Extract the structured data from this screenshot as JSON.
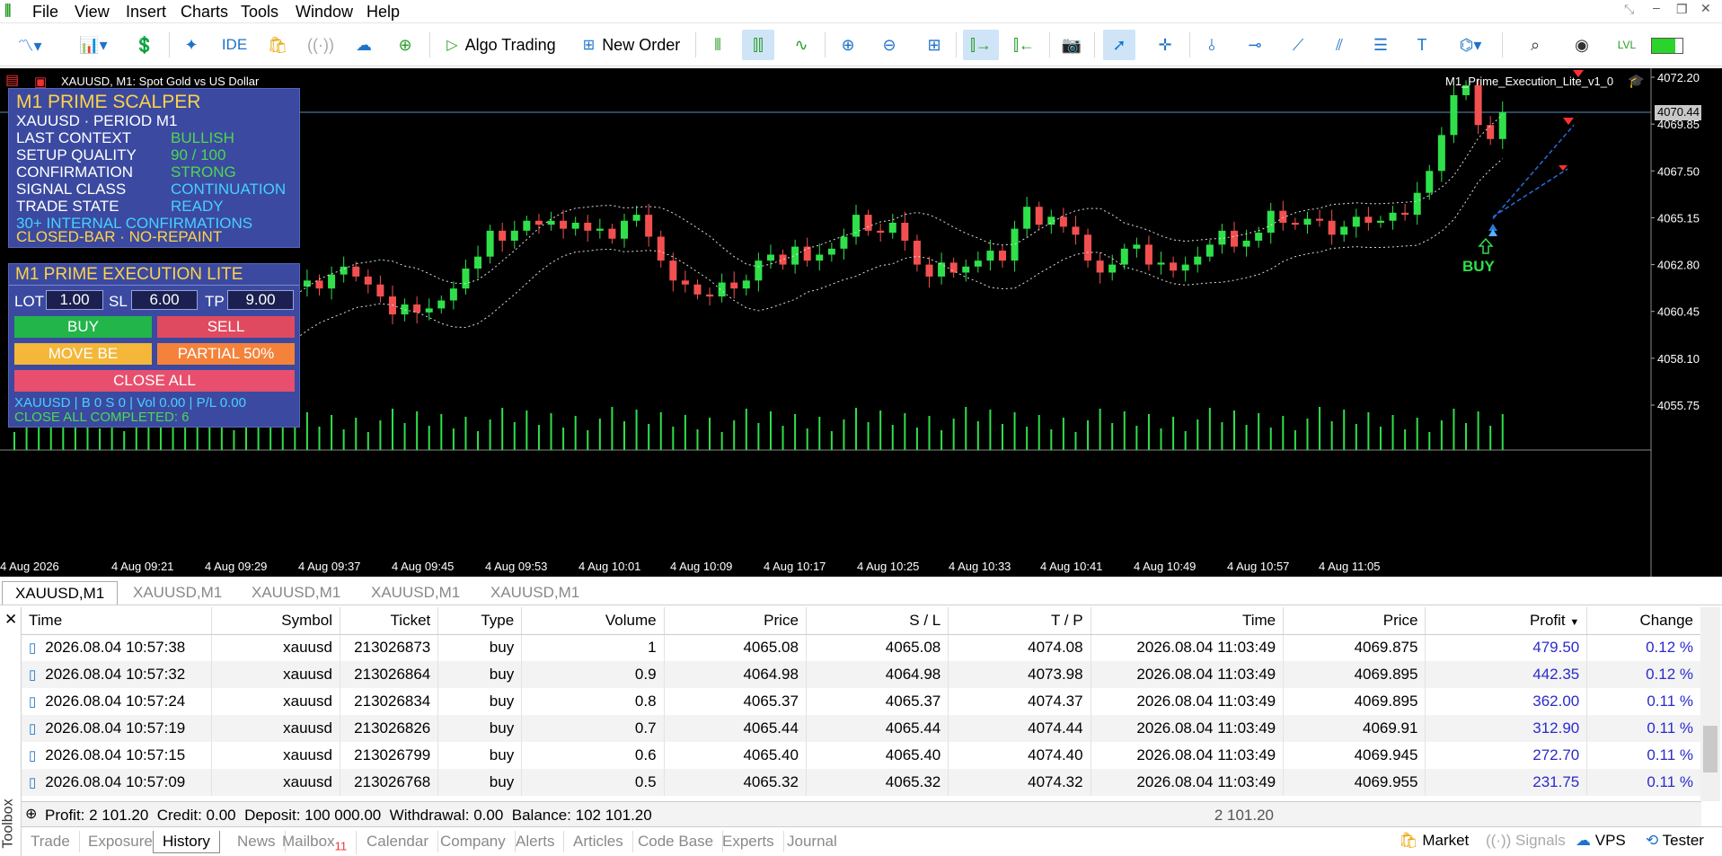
{
  "menu": [
    "File",
    "View",
    "Insert",
    "Charts",
    "Tools",
    "Window",
    "Help"
  ],
  "toolbar": {
    "ide": "IDE",
    "algo_trading": "Algo Trading",
    "new_order": "New Order"
  },
  "chart": {
    "title": "XAUUSD, M1:  Spot Gold vs US Dollar",
    "ea_label": "M1_Prime_Execution_Lite_v1_0",
    "price_labels": [
      "4072.20",
      "4069.85",
      "4067.50",
      "4065.15",
      "4062.80",
      "4060.45",
      "4058.10",
      "4055.75"
    ],
    "current_price": "4070.44",
    "time_labels": [
      "4 Aug 2026",
      "4 Aug 09:21",
      "4 Aug 09:29",
      "4 Aug 09:37",
      "4 Aug 09:45",
      "4 Aug 09:53",
      "4 Aug 10:01",
      "4 Aug 10:09",
      "4 Aug 10:17",
      "4 Aug 10:25",
      "4 Aug 10:33",
      "4 Aug 10:41",
      "4 Aug 10:49",
      "4 Aug 10:57",
      "4 Aug 11:05"
    ],
    "buy_signal": "BUY",
    "up_color": "#2fe04a",
    "down_color": "#f25050"
  },
  "scalper": {
    "title": "M1 PRIME SCALPER",
    "subtitle": "XAUUSD · PERIOD M1",
    "rows": [
      {
        "label": "LAST CONTEXT",
        "value": "BULLISH"
      },
      {
        "label": "SETUP QUALITY",
        "value": "90 / 100"
      },
      {
        "label": "CONFIRMATION",
        "value": "STRONG"
      },
      {
        "label": "SIGNAL CLASS",
        "value": "CONTINUATION"
      },
      {
        "label": "TRADE STATE",
        "value": "READY"
      }
    ],
    "line1": "30+ INTERNAL CONFIRMATIONS",
    "line2": "CLOSED-BAR · NO-REPAINT"
  },
  "execution": {
    "title": "M1 PRIME EXECUTION LITE",
    "lot_label": "LOT",
    "lot": "1.00",
    "sl_label": "SL",
    "sl": "6.00",
    "tp_label": "TP",
    "tp": "9.00",
    "buy": "BUY",
    "sell": "SELL",
    "move_be": "MOVE BE",
    "partial": "PARTIAL 50%",
    "close_all": "CLOSE ALL",
    "status": "XAUUSD | B 0 S 0 | Vol 0.00 | P/L 0.00",
    "completed": "CLOSE ALL COMPLETED: 6"
  },
  "chart_tabs": [
    "XAUUSD,M1",
    "XAUUSD,M1",
    "XAUUSD,M1",
    "XAUUSD,M1",
    "XAUUSD,M1"
  ],
  "table": {
    "headers": [
      "Time",
      "Symbol",
      "Ticket",
      "Type",
      "Volume",
      "Price",
      "S / L",
      "T / P",
      "Time",
      "Price",
      "Profit",
      "Change"
    ],
    "rows": [
      [
        "2026.08.04 10:57:38",
        "xauusd",
        "213026873",
        "buy",
        "1",
        "4065.08",
        "4065.08",
        "4074.08",
        "2026.08.04 11:03:49",
        "4069.875",
        "479.50",
        "0.12 %"
      ],
      [
        "2026.08.04 10:57:32",
        "xauusd",
        "213026864",
        "buy",
        "0.9",
        "4064.98",
        "4064.98",
        "4073.98",
        "2026.08.04 11:03:49",
        "4069.895",
        "442.35",
        "0.12 %"
      ],
      [
        "2026.08.04 10:57:24",
        "xauusd",
        "213026834",
        "buy",
        "0.8",
        "4065.37",
        "4065.37",
        "4074.37",
        "2026.08.04 11:03:49",
        "4069.895",
        "362.00",
        "0.11 %"
      ],
      [
        "2026.08.04 10:57:19",
        "xauusd",
        "213026826",
        "buy",
        "0.7",
        "4065.44",
        "4065.44",
        "4074.44",
        "2026.08.04 11:03:49",
        "4069.91",
        "312.90",
        "0.11 %"
      ],
      [
        "2026.08.04 10:57:15",
        "xauusd",
        "213026799",
        "buy",
        "0.6",
        "4065.40",
        "4065.40",
        "4074.40",
        "2026.08.04 11:03:49",
        "4069.945",
        "272.70",
        "0.11 %"
      ],
      [
        "2026.08.04 10:57:09",
        "xauusd",
        "213026768",
        "buy",
        "0.5",
        "4065.32",
        "4065.32",
        "4074.32",
        "2026.08.04 11:03:49",
        "4069.955",
        "231.75",
        "0.11 %"
      ]
    ],
    "summary": "Profit: 2 101.20  Credit: 0.00  Deposit: 100 000.00  Withdrawal: 0.00  Balance: 102 101.20",
    "summary_total": "2 101.20"
  },
  "toolbox_label": "Toolbox",
  "bottom_tabs": [
    "Trade",
    "Exposure",
    "History",
    "News",
    "Mailbox",
    "Calendar",
    "Company",
    "Alerts",
    "Articles",
    "Code Base",
    "Experts",
    "Journal"
  ],
  "mailbox_count": "11",
  "status_right": {
    "market": "Market",
    "signals": "Signals",
    "vps": "VPS",
    "tester": "Tester"
  }
}
